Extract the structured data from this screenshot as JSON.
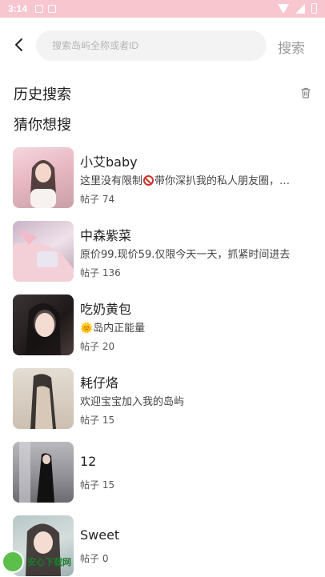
{
  "status_bar": {
    "time": "3:14"
  },
  "header": {
    "search_placeholder": "搜索岛屿全称或者ID",
    "search_button": "搜索"
  },
  "sections": {
    "history_title": "历史搜索",
    "suggest_title": "猜你想搜"
  },
  "islands": [
    {
      "name": "小艾baby",
      "desc_before": "这里没有限制",
      "desc_after": "带你深扒我的私人朋友圈，…",
      "posts": "帖子 74"
    },
    {
      "name": "中森紫菜",
      "desc": "原价99.现价59.仅限今天一天，抓紧时间进去",
      "posts": "帖子 136"
    },
    {
      "name": "吃奶黄包",
      "desc": "🌞岛内正能量",
      "posts": "帖子 20"
    },
    {
      "name": "耗仔烙",
      "desc": "欢迎宝宝加入我的岛屿",
      "posts": "帖子 15"
    },
    {
      "name": "12",
      "posts": "帖子 15"
    },
    {
      "name": "Sweet",
      "posts": "帖子 0"
    }
  ],
  "watermark": {
    "text": "安心下载网",
    "url": "www.java800.com"
  },
  "colors": {
    "status_bar": "#f8c6cf",
    "search_bg": "#f3f3f3"
  }
}
